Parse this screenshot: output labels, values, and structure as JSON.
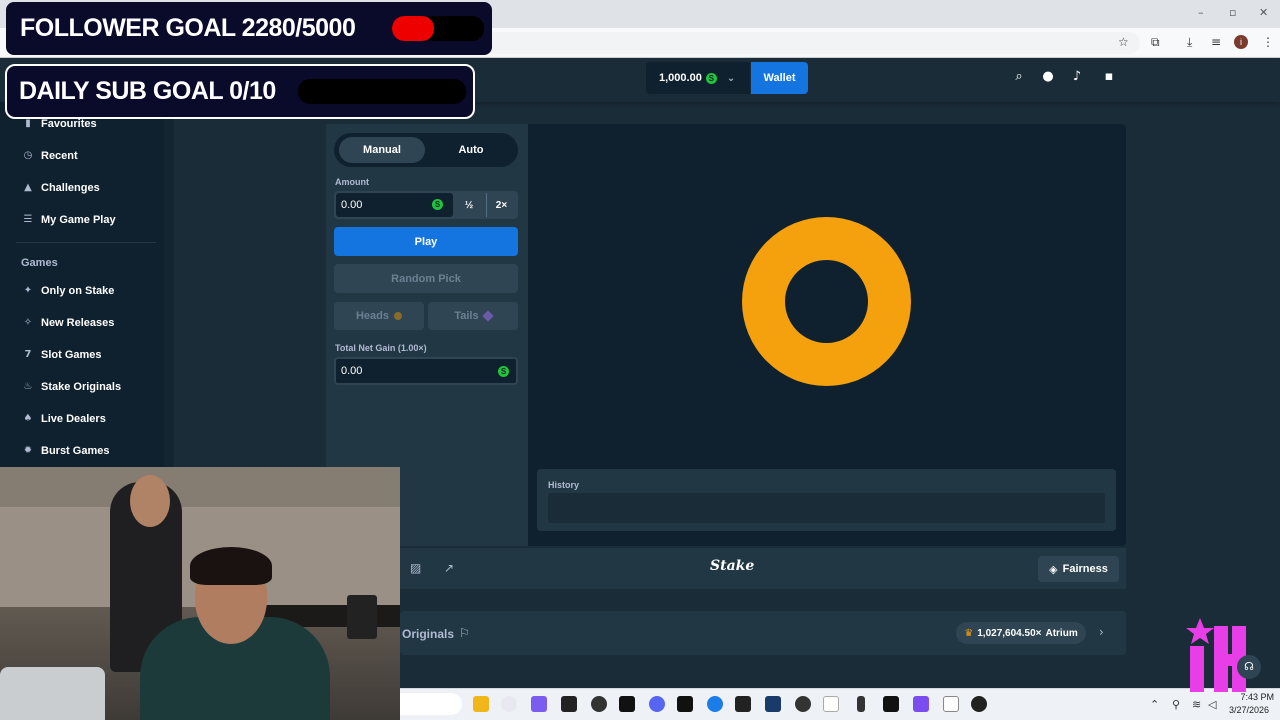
{
  "overlay": {
    "follower_goal": "FOLLOWER GOAL 2280/5000",
    "follower_progress": 0.456,
    "sub_goal": "DAILY SUB GOAL 0/10",
    "sub_progress": 0.0
  },
  "header": {
    "balance": "1,000.00",
    "currency_symbol": "S",
    "wallet_label": "Wallet"
  },
  "sidebar": {
    "items_top": [
      {
        "label": "Favourites",
        "icon": "bookmark-icon"
      },
      {
        "label": "Recent",
        "icon": "clock-icon"
      },
      {
        "label": "Challenges",
        "icon": "trophy-icon"
      },
      {
        "label": "My Game Play",
        "icon": "list-icon"
      }
    ],
    "section_games": "Games",
    "items_games": [
      {
        "label": "Only on Stake",
        "icon": "star-icon"
      },
      {
        "label": "New Releases",
        "icon": "sparkle-icon"
      },
      {
        "label": "Slot Games",
        "icon": "slots-icon"
      },
      {
        "label": "Stake Originals",
        "icon": "flame-icon"
      },
      {
        "label": "Live Dealers",
        "icon": "dealer-icon"
      },
      {
        "label": "Burst Games",
        "icon": "burst-icon"
      }
    ]
  },
  "game": {
    "tab_manual": "Manual",
    "tab_auto": "Auto",
    "amount_label": "Amount",
    "amount_value": "0.00",
    "half_label": "½",
    "double_label": "2×",
    "play_label": "Play",
    "random_label": "Random Pick",
    "heads_label": "Heads",
    "tails_label": "Tails",
    "gain_label": "Total Net Gain (1.00×)",
    "gain_value": "0.00",
    "history_label": "History",
    "coin_color": "#f5a10d"
  },
  "footer": {
    "brand": "Stake",
    "fairness_label": "Fairness",
    "originals_label": "Originals",
    "record_value": "1,027,604.50×",
    "record_user": "Atrium"
  },
  "taskbar": {
    "time": "7:43 PM",
    "date": "3/27/2026"
  },
  "colors": {
    "bg": "#1a2c38",
    "panel": "#213743",
    "dark": "#0f212e",
    "accent_blue": "#1475e1",
    "coin_green": "#1fc53a"
  }
}
